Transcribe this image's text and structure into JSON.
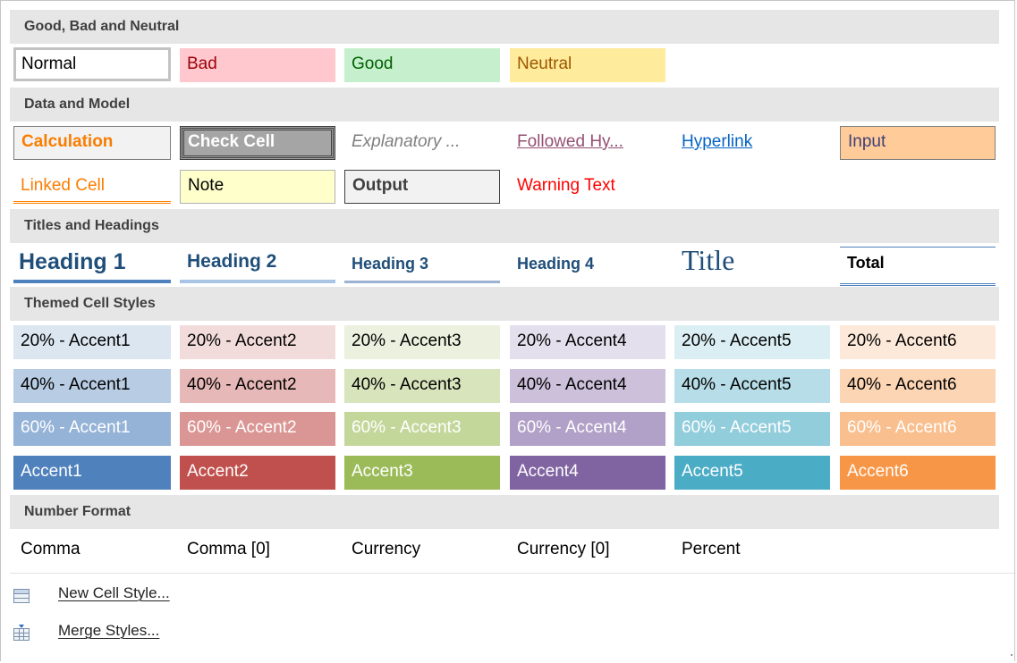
{
  "sections": {
    "good_bad_neutral": "Good, Bad and Neutral",
    "data_model": "Data and Model",
    "titles_headings": "Titles and Headings",
    "themed": "Themed Cell Styles",
    "number_format": "Number Format"
  },
  "good_bad_neutral": {
    "normal": "Normal",
    "bad": "Bad",
    "good": "Good",
    "neutral": "Neutral"
  },
  "data_model": {
    "calculation": "Calculation",
    "check_cell": "Check Cell",
    "explanatory": "Explanatory ...",
    "followed": "Followed Hy...",
    "hyperlink": "Hyperlink",
    "input": "Input",
    "linked_cell": "Linked Cell",
    "note": "Note",
    "output": "Output",
    "warning": "Warning Text"
  },
  "titles": {
    "h1": "Heading 1",
    "h2": "Heading 2",
    "h3": "Heading 3",
    "h4": "Heading 4",
    "title": "Title",
    "total": "Total"
  },
  "themed": {
    "p20": [
      "20% - Accent1",
      "20% - Accent2",
      "20% - Accent3",
      "20% - Accent4",
      "20% - Accent5",
      "20% - Accent6"
    ],
    "p40": [
      "40% - Accent1",
      "40% - Accent2",
      "40% - Accent3",
      "40% - Accent4",
      "40% - Accent5",
      "40% - Accent6"
    ],
    "p60": [
      "60% - Accent1",
      "60% - Accent2",
      "60% - Accent3",
      "60% - Accent4",
      "60% - Accent5",
      "60% - Accent6"
    ],
    "accent": [
      "Accent1",
      "Accent2",
      "Accent3",
      "Accent4",
      "Accent5",
      "Accent6"
    ]
  },
  "number_format": {
    "comma": "Comma",
    "comma0": "Comma [0]",
    "currency": "Currency",
    "currency0": "Currency [0]",
    "percent": "Percent"
  },
  "menu": {
    "new_style": "New Cell Style...",
    "merge_styles": "Merge Styles..."
  },
  "icons": {
    "new_style": "new-cell-style-icon",
    "merge_styles": "merge-styles-icon"
  }
}
